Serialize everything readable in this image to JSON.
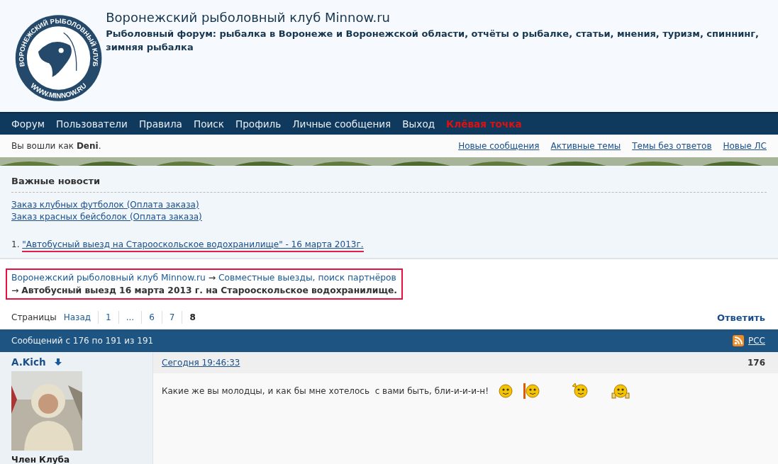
{
  "header": {
    "logo": {
      "ring_top": "ВОРОНЕЖСКИЙ РЫБОЛОВНЫЙ КЛУБ",
      "ring_bottom": "WWW.MINNOW.RU"
    },
    "title": "Воронежский рыболовный клуб Minnow.ru",
    "description": "Рыболовный форум: рыбалка в Воронеже и Воронежской области, отчёты о рыбалке, статьи, мнения, туризм, спиннинг, зимняя рыбалка"
  },
  "nav": [
    {
      "label": "Форум",
      "kind": "normal"
    },
    {
      "label": "Пользователи",
      "kind": "normal"
    },
    {
      "label": "Правила",
      "kind": "normal"
    },
    {
      "label": "Поиск",
      "kind": "normal"
    },
    {
      "label": "Профиль",
      "kind": "normal"
    },
    {
      "label": "Личные сообщения",
      "kind": "normal"
    },
    {
      "label": "Выход",
      "kind": "normal"
    },
    {
      "label": "Клёвая точка",
      "kind": "highlight"
    }
  ],
  "status": {
    "text": "Вы вошли как **Deni**.",
    "links": [
      "Новые сообщения",
      "Активные темы",
      "Темы без ответов",
      "Новые ЛС"
    ]
  },
  "announcement": {
    "title": "Важные новости",
    "links": [
      "Заказ клубных футболок (Оплата заказа)",
      "Заказ красных бейсболок (Оплата заказа)"
    ],
    "items": [
      {
        "number": "1.",
        "text": "\"Автобусный выезд на Старооскольское водохранилище\" - 16 марта 2013г.",
        "underlined": true
      }
    ]
  },
  "breadcrumb": {
    "highlighted": true,
    "links": [
      "Воронежский рыболовный клуб Minnow.ru",
      "Совместные выезды, поиск партнёров"
    ],
    "separator": "→",
    "current": "Автобусный выезд 16 марта 2013 г. на Старооскольское водохранилище."
  },
  "pagination": {
    "label": "Страницы",
    "pages": [
      {
        "label": "Назад",
        "selected": false
      },
      {
        "label": "1",
        "selected": false
      },
      {
        "label": "...",
        "selected": false
      },
      {
        "label": "6",
        "selected": false
      },
      {
        "label": "7",
        "selected": false
      },
      {
        "label": "8",
        "selected": true
      }
    ],
    "reply": "Ответить"
  },
  "topic_bar": {
    "text": "Сообщений с 176 по 191 из 191",
    "rss": "РСС"
  },
  "posts": [
    {
      "author": "A.Kich",
      "rank": "Член Клуба",
      "date": "Сегодня 19:46:33",
      "number": "176",
      "text": "Какие же вы молодцы, и как бы мне хотелось  с вами быть, бли-и-и-и-н!",
      "smileys": [
        {
          "kind": "smile"
        },
        {
          "kind": "sign"
        },
        {
          "kind": "wave"
        },
        {
          "kind": "cheers"
        }
      ]
    }
  ]
}
